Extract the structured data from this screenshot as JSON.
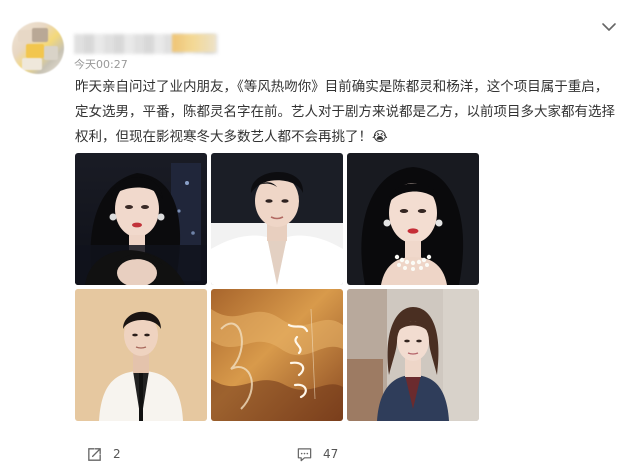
{
  "post": {
    "author": {
      "name": "",
      "badge": ""
    },
    "timestamp": "今天00:27",
    "text": "昨天亲自问过了业内朋友，《等风热吻你》目前确实是陈都灵和杨洋，这个项目属于重启，定女选男，平番，陈都灵名字在前。艺人对于剧方来说都是乙方，以前项目多大家都有选择权利，但现在影视寒冬大多数艺人都不会再挑了！😭",
    "more_icon": "chevron-down-icon",
    "images": [
      {
        "name": "photo-actress-portrait-night",
        "alt": ""
      },
      {
        "name": "photo-actor-portrait-dark",
        "alt": ""
      },
      {
        "name": "photo-actress-pearls",
        "alt": ""
      },
      {
        "name": "photo-actor-white-suit",
        "alt": ""
      },
      {
        "name": "photo-poster-golden",
        "alt": ""
      },
      {
        "name": "photo-actress-street",
        "alt": ""
      }
    ],
    "actions": {
      "share_icon": "share-icon",
      "share_count": "2",
      "comment_icon": "comment-icon",
      "comment_count": "47"
    },
    "colors": {
      "text": "#333333",
      "muted": "#999999",
      "background": "#ffffff"
    }
  }
}
